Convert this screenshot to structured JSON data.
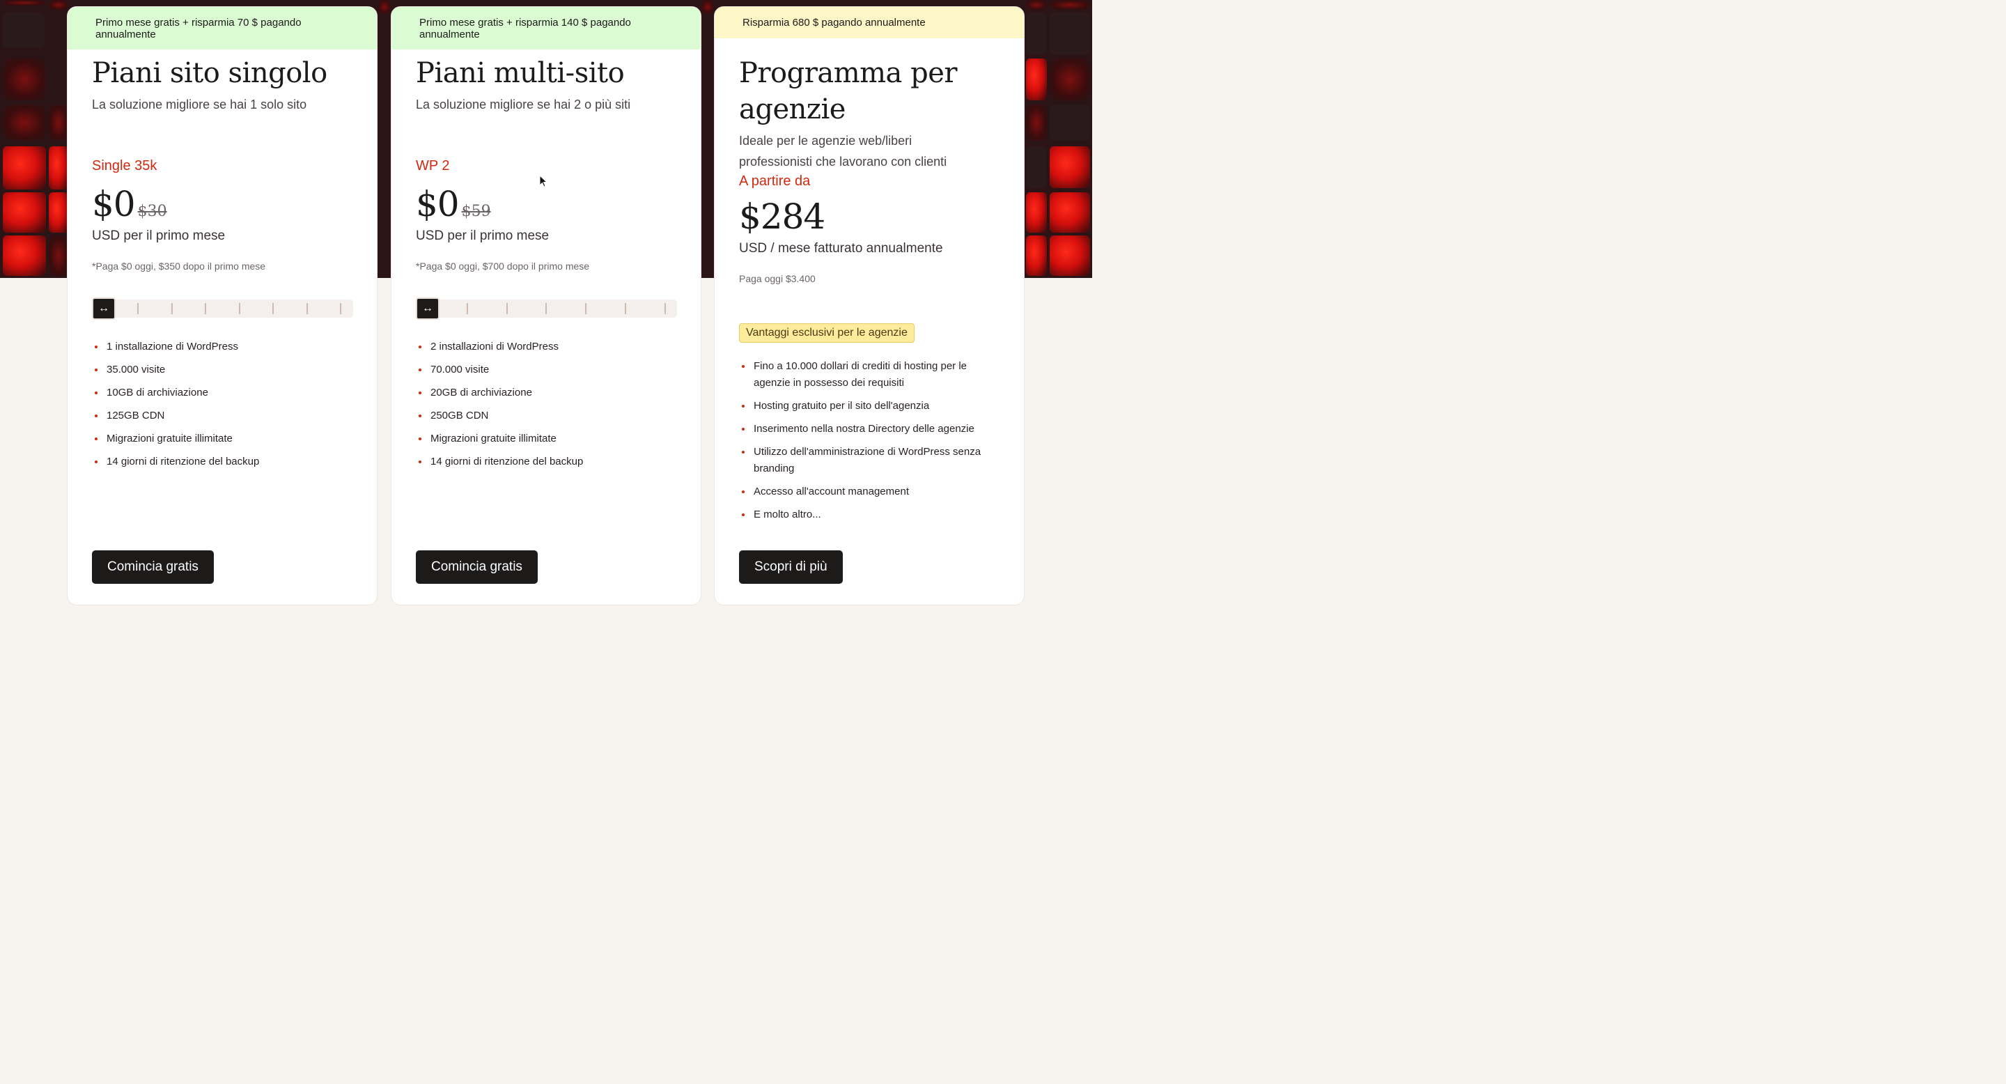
{
  "plans": [
    {
      "banner": "Primo mese gratis + risparmia 70 $ pagando annualmente",
      "title": "Piani sito singolo",
      "subtitle": "La soluzione migliore se hai 1 solo sito",
      "plan_name": "Single 35k",
      "price": "$0",
      "old_price": "$30",
      "price_unit": "USD per il primo mese",
      "price_note": "*Paga $0 oggi, $350 dopo il primo mese",
      "slider_handle_icon": "↔",
      "features": [
        "1 installazione di WordPress",
        "35.000 visite",
        "10GB di archiviazione",
        "125GB CDN",
        "Migrazioni gratuite illimitate",
        "14 giorni di ritenzione del backup"
      ],
      "cta": "Comincia gratis"
    },
    {
      "banner": "Primo mese gratis + risparmia 140 $ pagando annualmente",
      "title": "Piani multi-sito",
      "subtitle": "La soluzione migliore se hai 2 o più siti",
      "plan_name": "WP 2",
      "price": "$0",
      "old_price": "$59",
      "price_unit": "USD per il primo mese",
      "price_note": "*Paga $0 oggi, $700 dopo il primo mese",
      "slider_handle_icon": "↔",
      "features": [
        "2 installazioni di WordPress",
        "70.000 visite",
        "20GB di archiviazione",
        "250GB CDN",
        "Migrazioni gratuite illimitate",
        "14 giorni di ritenzione del backup"
      ],
      "cta": "Comincia gratis"
    },
    {
      "banner": "Risparmia 680 $ pagando annualmente",
      "title": "Programma per agenzie",
      "subtitle": "Ideale per le agenzie web/liberi professionisti che lavorano con clienti",
      "plan_name": "A partire da",
      "price": "$284",
      "price_unit": "USD / mese fatturato annualmente",
      "price_note": "Paga oggi $3.400",
      "badge": "Vantaggi esclusivi per le agenzie",
      "features": [
        "Fino a 10.000 dollari di crediti di hosting per le agenzie in possesso dei requisiti",
        "Hosting gratuito per il sito dell'agenzia",
        "Inserimento nella nostra Directory delle agenzie",
        "Utilizzo dell'amministrazione di WordPress senza branding",
        "Accesso all'account management",
        "E molto altro..."
      ],
      "cta": "Scopri di più"
    }
  ],
  "colors": {
    "accent": "#d0290f",
    "banner_green": "#dbfbd3",
    "banner_yellow": "#fdf6c6",
    "button": "#1d1a1a",
    "hero_bg": "#2a1416"
  }
}
